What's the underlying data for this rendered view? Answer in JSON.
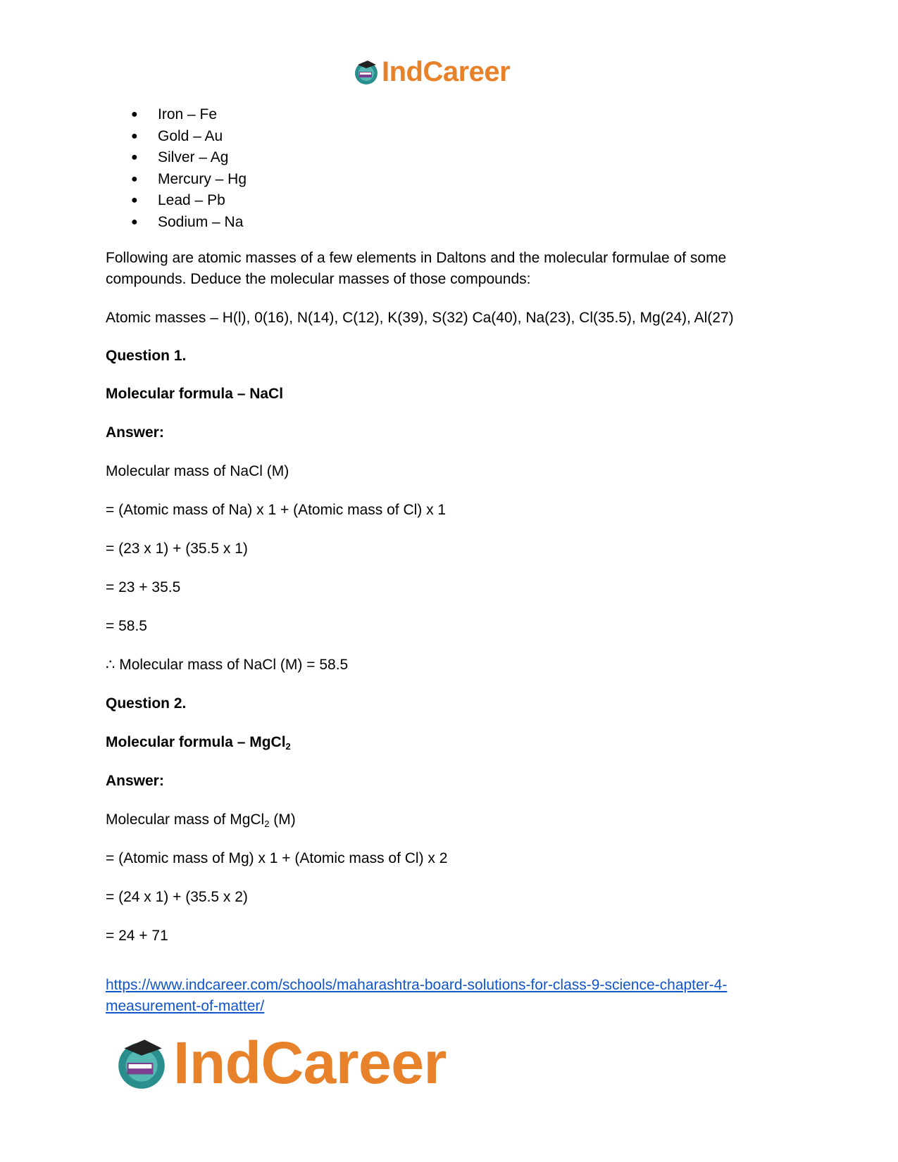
{
  "header": {
    "logo_text": "IndCareer"
  },
  "elements_list": [
    "Iron – Fe",
    "Gold – Au",
    "Silver – Ag",
    "Mercury – Hg",
    "Lead – Pb",
    "Sodium – Na"
  ],
  "intro": "Following are atomic masses of a few elements in Daltons and the molecular formulae of some compounds. Deduce the molecular masses of those compounds:",
  "atomic_masses": "Atomic masses – H(l), 0(16), N(14), C(12), K(39), S(32) Ca(40), Na(23), Cl(35.5), Mg(24), Al(27)",
  "q1": {
    "title": "Question 1.",
    "formula_label": "Molecular formula – NaCl",
    "answer_label": "Answer:",
    "lines": [
      "Molecular mass of NaCl (M)",
      "= (Atomic mass of Na) x 1 + (Atomic mass of Cl) x 1",
      "= (23 x 1) + (35.5 x 1)",
      "= 23 + 35.5",
      "= 58.5",
      "∴ Molecular mass of NaCl (M) = 58.5"
    ]
  },
  "q2": {
    "title": "Question 2.",
    "formula_prefix": "Molecular formula – MgCl",
    "formula_sub": "2",
    "answer_label": "Answer:",
    "mass_prefix": "Molecular mass of MgCl",
    "mass_sub": "2",
    "mass_suffix": " (M)",
    "lines": [
      "= (Atomic mass of Mg) x 1 + (Atomic mass of Cl) x 2",
      "= (24 x 1) + (35.5 x 2)",
      "= 24 + 71"
    ]
  },
  "footer": {
    "link_line1": "https://www.indcareer.com/schools/maharashtra-board-solutions-for-class-9-science-chapter-4-",
    "link_line2": "measurement-of-matter/",
    "logo_text": "IndCareer"
  }
}
